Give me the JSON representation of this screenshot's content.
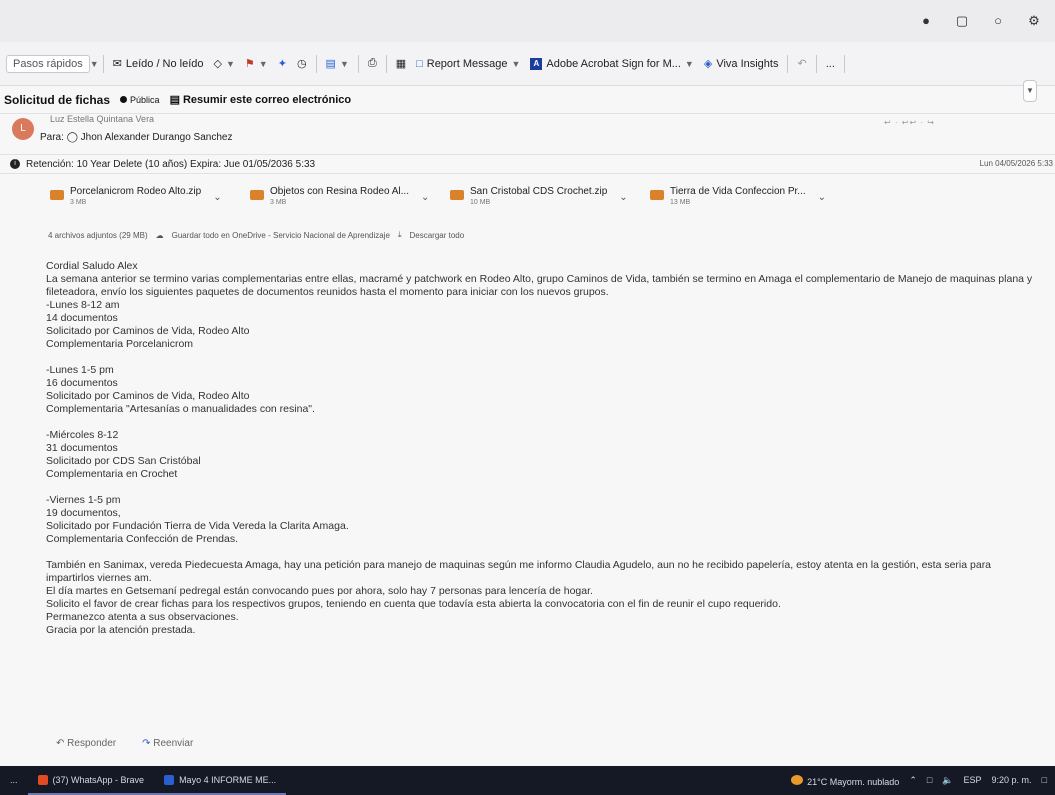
{
  "ribbon": {
    "quick_steps": "Pasos rápidos",
    "read_unread": "Leído / No leído",
    "report_message": "Report Message",
    "acrobat": "Adobe Acrobat Sign for M...",
    "viva": "Viva Insights",
    "more": "..."
  },
  "subject": {
    "title": "Solicitud de fichas",
    "visibility": "Pública",
    "summarize": "Resumir este correo electrónico"
  },
  "sender": {
    "avatar_letter": "L",
    "name": "Luz Estella Quintana Vera",
    "to_label": "Para:",
    "to": "Jhon Alexander Durango Sanchez"
  },
  "retention": {
    "text": "Retención: 10 Year Delete (10 años) Expira: Jue 01/05/2036 5:33",
    "date": "Lun 04/05/2026 5:33"
  },
  "attachments": [
    {
      "name": "Porcelanicrom Rodeo Alto.zip",
      "size": "3 MB"
    },
    {
      "name": "Objetos con Resina Rodeo Al...",
      "size": "3 MB"
    },
    {
      "name": "San Cristobal CDS Crochet.zip",
      "size": "10 MB"
    },
    {
      "name": "Tierra de Vida Confeccion Pr...",
      "size": "13 MB"
    }
  ],
  "attachments_meta": {
    "count": "4 archivos adjuntos (29 MB)",
    "save_onedrive": "Guardar todo en OneDrive - Servicio Nacional de Aprendizaje",
    "download_all": "Descargar todo"
  },
  "body": {
    "greeting": "Cordial Saludo Alex",
    "intro": "La semana anterior se termino varias  complementarias  entre ellas, macramé y patchwork en Rodeo Alto,  grupo Caminos de Vida,  también se termino en Amaga el complementario de Manejo de maquinas plana y fileteadora,  envío  los siguientes paquetes  de documentos  reunidos hasta el momento para iniciar con  los nuevos grupos.",
    "groups": [
      {
        "l1": "-Lunes 8-12  am",
        "l2": "14 documentos",
        "l3": "Solicitado por Caminos de Vida, Rodeo Alto",
        "l4": "Complementaria  Porcelanicrom"
      },
      {
        "l1": "-Lunes 1-5 pm",
        "l2": "16 documentos",
        "l3": "Solicitado por Caminos de Vida, Rodeo Alto",
        "l4": "Complementaria \"Artesanías  o manualidades con resina\"."
      },
      {
        "l1": "-Miércoles 8-12",
        "l2": "31 documentos",
        "l3": "Solicitado por CDS San Cristóbal",
        "l4": "Complementaria en Crochet"
      },
      {
        "l1": "-Viernes  1-5 pm",
        "l2": "19 documentos,",
        "l3": "Solicitado por Fundación Tierra de Vida  Vereda la Clarita Amaga.",
        "l4": "Complementaria Confección de Prendas."
      }
    ],
    "p1": "También en Sanimax, vereda Piedecuesta Amaga, hay una petición para manejo de maquinas según me informo Claudia Agudelo, aun no he recibido papelería, estoy atenta en la gestión,  esta  seria para impartirlos viernes am.",
    "p2": "El día martes en Getsemaní  pedregal  están convocando pues por ahora, solo hay  7 personas para lencería de hogar.",
    "p3": "Solicito el favor de crear  fichas para los respectivos grupos, teniendo en cuenta que todavía esta abierta la convocatoria con el fin de reunir el cupo requerido.",
    "p4": "Permanezco atenta a sus observaciones.",
    "p5": "Gracia por la atención prestada."
  },
  "actions": {
    "reply": "Responder",
    "forward": "Reenviar"
  },
  "taskbar": {
    "item0": "...",
    "whatsapp": "(37) WhatsApp - Brave",
    "word": "Mayo 4 INFORME ME...",
    "weather": "21°C  Mayorm. nublado",
    "lang": "ESP",
    "time": "9:20 p. m."
  }
}
